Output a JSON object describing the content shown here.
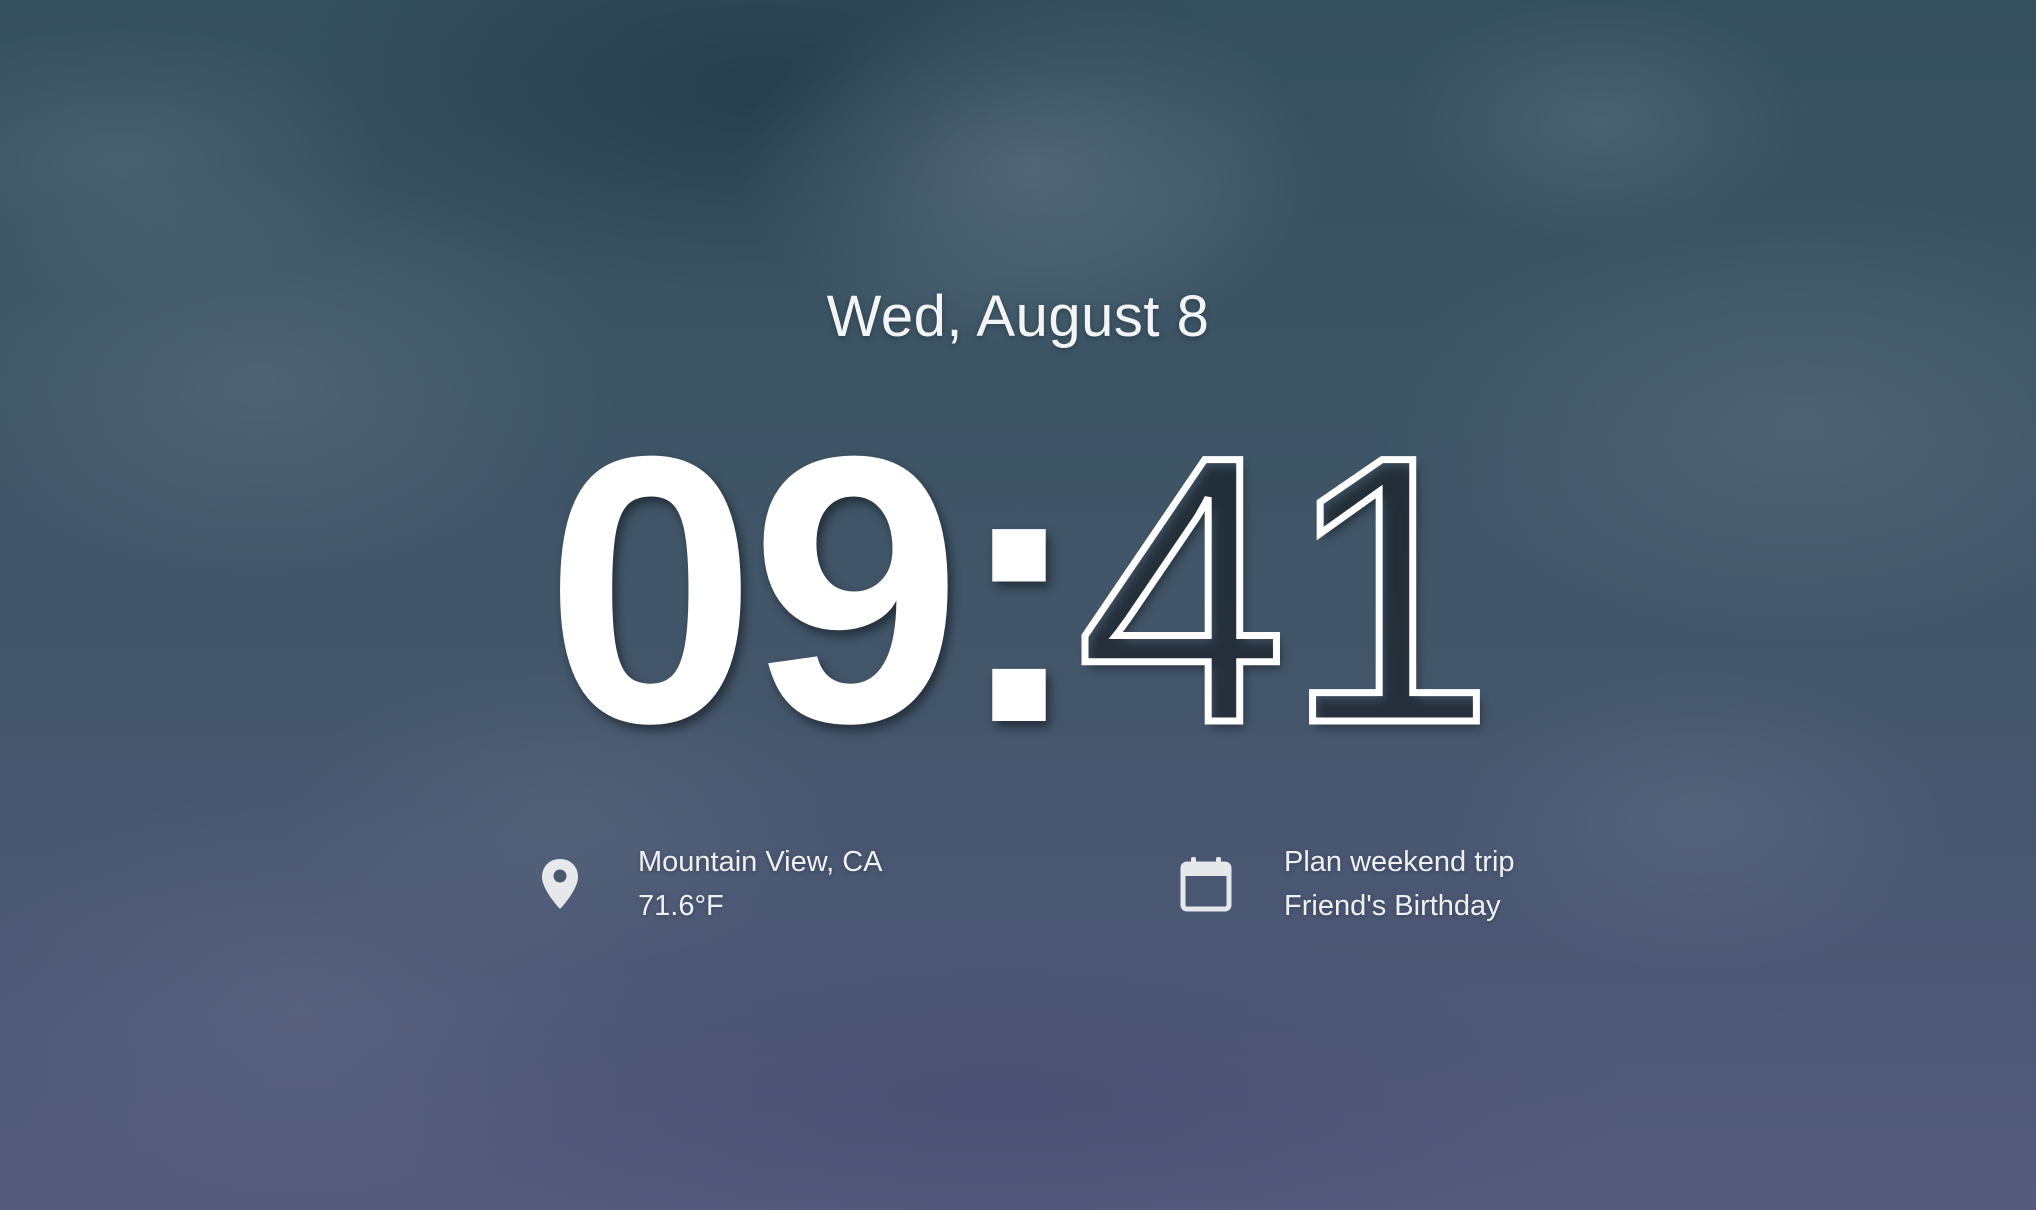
{
  "date": "Wed, August 8",
  "clock": {
    "hours": "09",
    "separator": ":",
    "minutes": "41"
  },
  "weather": {
    "icon": "location-pin-icon",
    "location": "Mountain View, CA",
    "temperature": "71.6°F"
  },
  "calendar": {
    "icon": "calendar-icon",
    "events": [
      "Plan weekend trip",
      "Friend's Birthday"
    ]
  },
  "colors": {
    "text": "#ffffff",
    "icon": "#e6e8ec",
    "background_top": "#35505d",
    "background_bottom": "#565b7e"
  }
}
